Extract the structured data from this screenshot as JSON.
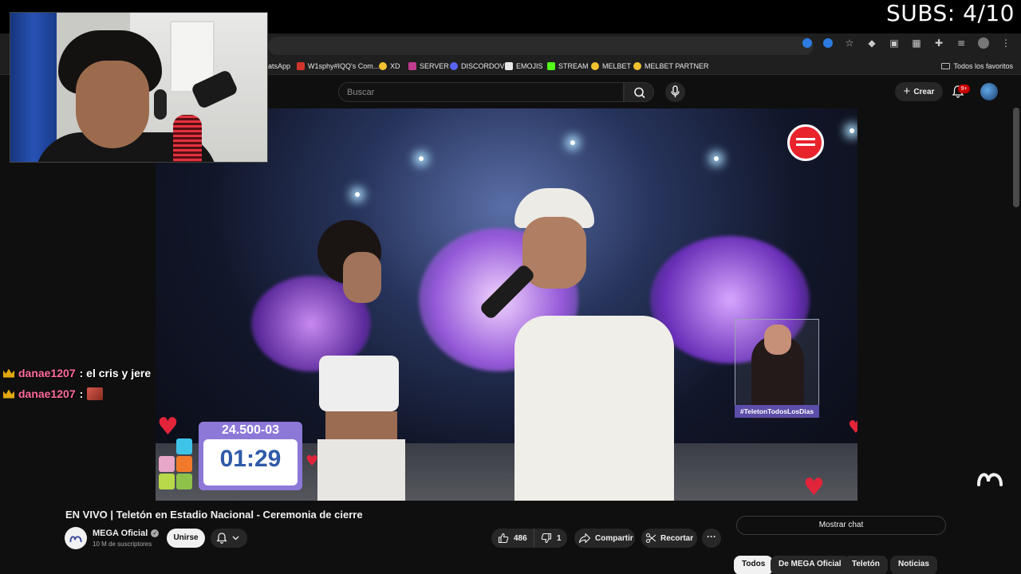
{
  "overlay": {
    "subs_counter": "SUBS: 4/10"
  },
  "browser": {
    "bookmarks": [
      {
        "label": "atsApp",
        "color": "#1f1f1f"
      },
      {
        "label": "W1sphy#IQQ's Com...",
        "color": "#d0342c"
      },
      {
        "label": "XD",
        "color": "#f2c230"
      },
      {
        "label": "SERVER",
        "color": "#c33c8f"
      },
      {
        "label": "DISCORDOV",
        "color": "#5865f2"
      },
      {
        "label": "EMOJIS",
        "color": "#e8e8e8"
      },
      {
        "label": "STREAM",
        "color": "#53fc18"
      },
      {
        "label": "MELBET",
        "color": "#f2c230"
      },
      {
        "label": "MELBET PARTNER",
        "color": "#f2c230"
      }
    ],
    "favorites_label": "Todos los favoritos"
  },
  "youtube": {
    "search_placeholder": "Buscar",
    "create_label": "Crear",
    "notifications_badge": "9+"
  },
  "stream_chat": [
    {
      "user": "danae1207",
      "message": ": el cris y jere",
      "emote": false
    },
    {
      "user": "danae1207",
      "message": ":",
      "emote": true
    }
  ],
  "video_overlay": {
    "donation_number": "24.500-03",
    "timer": "01:29",
    "hashtag": "#TeletonTodosLosDias"
  },
  "video": {
    "title": "EN VIVO | Teletón en Estadio Nacional - Ceremonia de cierre",
    "channel_name": "MEGA Oficial",
    "subscribers": "10 M de suscriptores",
    "join_label": "Unirse",
    "likes": "486",
    "dislikes": "1",
    "share_label": "Compartir",
    "clip_label": "Recortar",
    "more_label": "···",
    "show_chat_label": "Mostrar chat"
  },
  "chips": [
    {
      "label": "Todos",
      "active": true
    },
    {
      "label": "De MEGA Oficial",
      "active": false
    },
    {
      "label": "Teletón",
      "active": false
    },
    {
      "label": "Noticias",
      "active": false
    }
  ],
  "colors": {
    "accent_red": "#cc0000",
    "chat_user": "#ff6b9e",
    "counter_bg": "#8d78d8",
    "timer_text": "#2f5aa8"
  }
}
